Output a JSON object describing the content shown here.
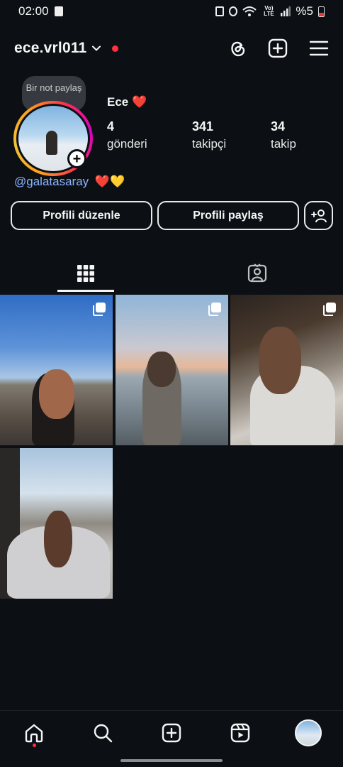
{
  "status_bar": {
    "time": "02:00",
    "battery": "%5",
    "network": "Vo) LTE"
  },
  "header": {
    "username": "ece.vrl011",
    "icons": [
      "threads-icon",
      "create-icon",
      "menu-icon"
    ]
  },
  "profile": {
    "note_text": "Bir not paylaş",
    "display_name": "Ece ❤️",
    "stats": [
      {
        "value": "4",
        "label": "gönderi"
      },
      {
        "value": "341",
        "label": "takipçi"
      },
      {
        "value": "34",
        "label": "takip"
      }
    ],
    "bio_link": "@galatasaray",
    "bio_emoji_1": "❤️",
    "bio_emoji_2": "💛"
  },
  "actions": {
    "edit_label": "Profili düzenle",
    "share_label": "Profili paylaş"
  },
  "tabs": [
    "grid-tab",
    "tagged-tab"
  ],
  "posts": [
    {
      "type": "carousel"
    },
    {
      "type": "carousel"
    },
    {
      "type": "carousel"
    },
    {
      "type": "single"
    }
  ],
  "bottom_nav": [
    "home",
    "search",
    "create",
    "reels",
    "profile"
  ],
  "colors": {
    "background": "#0c1014",
    "notification": "#ff3040",
    "link": "#8ab4ff"
  }
}
